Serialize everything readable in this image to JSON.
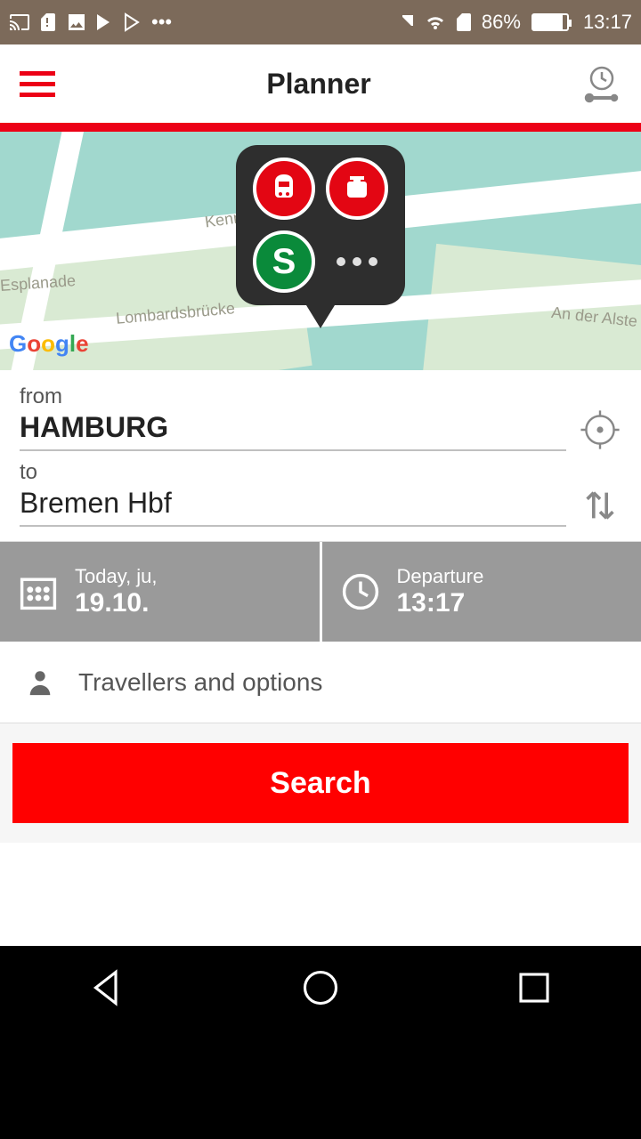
{
  "statusbar": {
    "battery_pct": "86%",
    "time": "13:17"
  },
  "header": {
    "title": "Planner"
  },
  "map": {
    "labels": {
      "kennedy": "Kenne",
      "lombard": "Lombardsbrücke",
      "esplanade": "Esplanade",
      "alster": "An der Alste"
    },
    "popup": {
      "s_label": "S"
    }
  },
  "form": {
    "from_label": "from",
    "from_value": "HAMBURG",
    "to_label": "to",
    "to_value": "Bremen Hbf"
  },
  "datetime": {
    "date_label": "Today, ju,",
    "date_value": "19.10.",
    "time_label": "Departure",
    "time_value": "13:17"
  },
  "options": {
    "label": "Travellers and options"
  },
  "search": {
    "label": "Search"
  }
}
